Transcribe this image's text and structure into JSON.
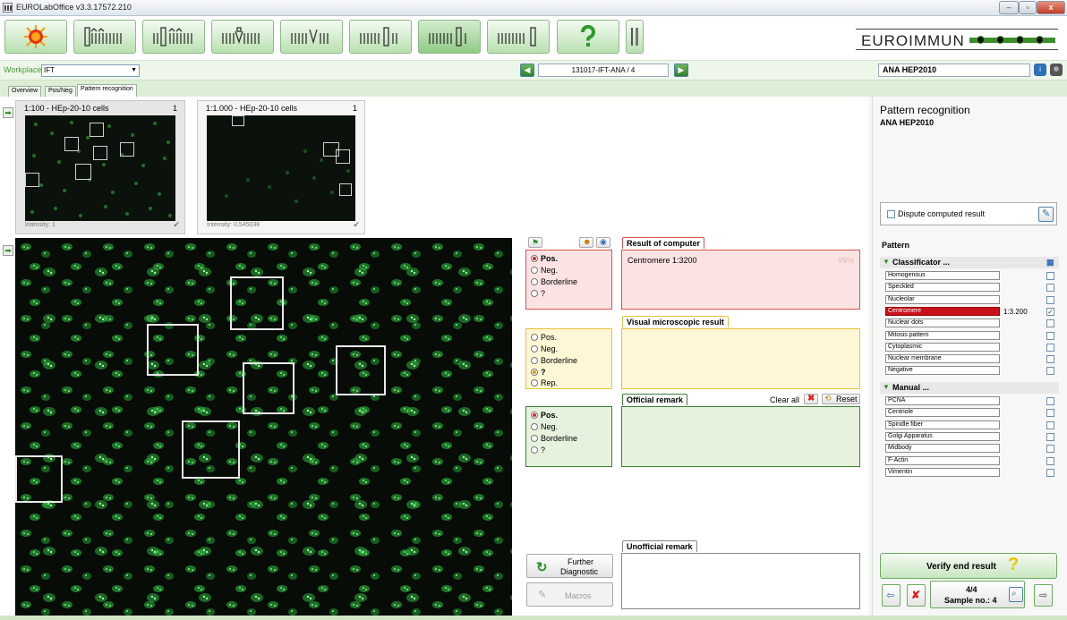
{
  "window": {
    "title": "EUROLabOffice v3.3.17572.210",
    "min": "–",
    "restore": "▫",
    "close": "x"
  },
  "brand": {
    "logo_text": "EUROIMMUN",
    "accent": "#3e8f2b"
  },
  "workplace": {
    "label": "Workplaces",
    "value": "IFT"
  },
  "sample_nav": {
    "prev_icon": "arrow-left-icon",
    "next_icon": "arrow-right-icon",
    "sample_id": "131017-IFT-ANA / 4"
  },
  "test_name": "ANA HEP2010",
  "tabs": [
    "Overview",
    "Pos/Neg",
    "Pattern recognition"
  ],
  "thumbs": [
    {
      "title": "1:100 - HEp-20-10 cells",
      "count": "1",
      "intensity": "Intensity: 1",
      "check": "✔"
    },
    {
      "title": "1:1.000 - HEp-20-10 cells",
      "count": "1",
      "intensity": "Intensity: 0,545038",
      "check": "✔"
    }
  ],
  "computer_group": {
    "options": [
      "Pos.",
      "Neg.",
      "Borderline",
      "?"
    ],
    "selected": "Pos."
  },
  "visual_group": {
    "options": [
      "Pos.",
      "Neg.",
      "Borderline",
      "?",
      "Rep."
    ],
    "selected": "?"
  },
  "official_group": {
    "options": [
      "Pos.",
      "Neg.",
      "Borderline",
      "?"
    ],
    "selected": "Pos."
  },
  "result_computer": {
    "header": "Result of computer",
    "text": "Centromere 1:3200",
    "confidence": "99%"
  },
  "visual_result": {
    "header": "Visual microscopic result"
  },
  "official_remark": {
    "header": "Official remark",
    "clear_all": "Clear all",
    "reset": "Reset"
  },
  "unofficial_remark": {
    "header": "Unofficial remark"
  },
  "buttons": {
    "further_1": "Further",
    "further_2": "Diagnostic",
    "macros": "Macros"
  },
  "right": {
    "title": "Pattern recognition",
    "subtitle": "ANA HEP2010",
    "dispute": "Dispute computed result",
    "pattern_header": "Pattern",
    "classificator_header": "Classificator ...",
    "classificator": [
      {
        "name": "Homogenous",
        "value": "",
        "checked": false,
        "highlight": false
      },
      {
        "name": "Speckled",
        "value": "",
        "checked": false,
        "highlight": false
      },
      {
        "name": "Nucleolar",
        "value": "",
        "checked": false,
        "highlight": false
      },
      {
        "name": "Centromere",
        "value": "1:3.200",
        "checked": true,
        "highlight": true
      },
      {
        "name": "Nuclear dots",
        "value": "",
        "checked": false,
        "highlight": false
      },
      {
        "name": "Mitosis pattern",
        "value": "",
        "checked": false,
        "highlight": false
      },
      {
        "name": "Cytoplasmic",
        "value": "",
        "checked": false,
        "highlight": false
      },
      {
        "name": "Nuclear membrane",
        "value": "",
        "checked": false,
        "highlight": false
      },
      {
        "name": "Negative",
        "value": "",
        "checked": false,
        "highlight": false
      }
    ],
    "manual_header": "Manual ...",
    "manual": [
      "PCNA",
      "Centriole",
      "Spindle fiber",
      "Golgi Apparatus",
      "Midbody",
      "F-Actin",
      "Vimentin"
    ],
    "verify": "Verify end result",
    "sample_count": "4/4",
    "sample_no": "Sample no.: 4"
  }
}
